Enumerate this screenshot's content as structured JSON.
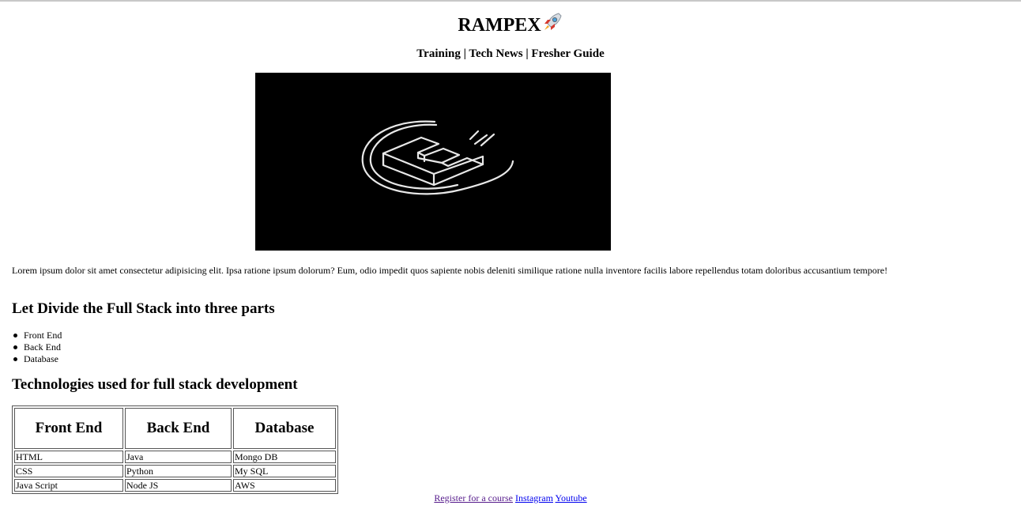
{
  "header": {
    "title": "RAMPEX",
    "nav": "Training | Tech News | Fresher Guide"
  },
  "intro": "Lorem ipsum dolor sit amet consectetur adipisicing elit. Ipsa ratione ipsum dolorum? Eum, odio impedit quos sapiente nobis deleniti similique ratione nulla inventore facilis labore repellendus totam doloribus accusantium tempore!",
  "sections": {
    "parts_heading": "Let Divide the Full Stack into three parts",
    "parts": [
      "Front End",
      "Back End",
      "Database"
    ],
    "tech_heading": "Technologies used for full stack development"
  },
  "table": {
    "headers": [
      "Front End",
      "Back End",
      "Database"
    ],
    "rows": [
      [
        "HTML",
        "Java",
        "Mongo DB"
      ],
      [
        "CSS",
        "Python",
        "My SQL"
      ],
      [
        "Java Script",
        "Node JS",
        "AWS"
      ]
    ]
  },
  "footer": {
    "register": "Register for a course",
    "instagram": "Instagram",
    "youtube": "Youtube"
  },
  "colors": {
    "link_visited": "#551a8b",
    "link_unvisited": "#0000ee",
    "hero_bg": "#000000"
  }
}
